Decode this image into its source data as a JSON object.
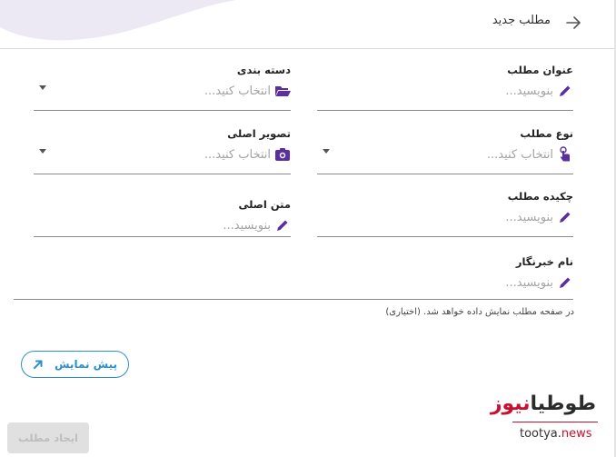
{
  "header": {
    "title": "مطلب جدید"
  },
  "fields": {
    "title": {
      "label": "عنوان مطلب",
      "placeholder": "بنویسید..."
    },
    "category": {
      "label": "دسته بندی",
      "placeholder": "انتخاب کنید..."
    },
    "type": {
      "label": "نوع مطلب",
      "placeholder": "انتخاب کنید..."
    },
    "main_image": {
      "label": "تصویر اصلی",
      "placeholder": "انتخاب کنید..."
    },
    "summary": {
      "label": "چکیده مطلب",
      "placeholder": "بنویسید..."
    },
    "main_text": {
      "label": "متن اصلی",
      "placeholder": "بنویسید..."
    },
    "reporter": {
      "label": "نام خبرنگار",
      "placeholder": "بنویسید...",
      "helper": "در صفحه مطلب نمایش داده خواهد شد. (اختیاری)"
    }
  },
  "buttons": {
    "preview": "پیش نمایش",
    "create": "ایجاد مطلب"
  },
  "logo": {
    "fa_dark": "طوطیا",
    "fa_red": "نیوز",
    "en_dark": "tootya.",
    "en_red": "news"
  },
  "colors": {
    "icon_purple": "#5b2fa0",
    "accent_blue": "#2a8fd1",
    "logo_red": "#c8102e"
  }
}
